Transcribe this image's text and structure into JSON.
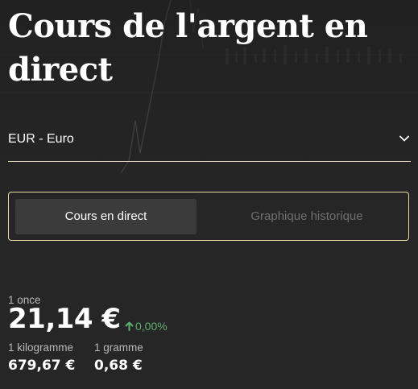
{
  "header": {
    "title": "Cours de l'argent en direct"
  },
  "currency_select": {
    "selected": "EUR - Euro",
    "icon": "chevron-down-icon"
  },
  "tabs": [
    {
      "label": "Cours en direct",
      "active": true
    },
    {
      "label": "Graphique historique",
      "active": false
    }
  ],
  "prices": {
    "ounce_label": "1 once",
    "ounce_value": "21,14 €",
    "change_icon": "arrow-up-icon",
    "change": "0,00%",
    "kilogram_label": "1 kilogramme",
    "kilogram_value": "679,67 €",
    "gram_label": "1 gramme",
    "gram_value": "0,68 €"
  },
  "colors": {
    "background": "#262626",
    "accent_border": "#e6dcaa",
    "positive": "#5fae71",
    "active_tab": "#3b3b3b"
  }
}
